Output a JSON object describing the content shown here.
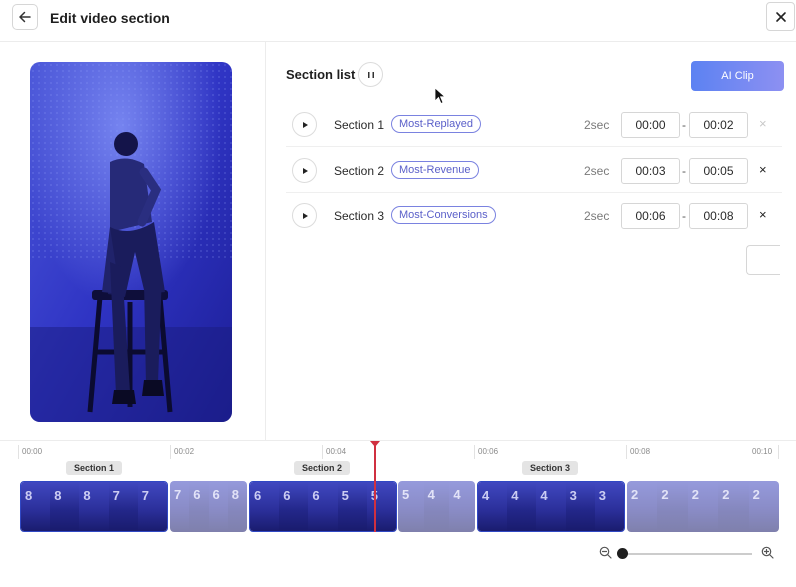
{
  "header": {
    "title": "Edit video section",
    "back_icon": "arrow-left-icon",
    "close_icon": "close-icon"
  },
  "section_list": {
    "title": "Section list",
    "pause_icon": "pause-icon",
    "ai_button_label": "AI Clip",
    "ai_colors": [
      "#5c82f2",
      "#8d90f2"
    ]
  },
  "sections": [
    {
      "name": "Section 1",
      "tag": "Most-Replayed",
      "duration": "2sec",
      "start": "00:00",
      "end": "00:02",
      "dash": "-",
      "remove": "×",
      "remove_disabled": true
    },
    {
      "name": "Section 2",
      "tag": "Most-Revenue",
      "duration": "2sec",
      "start": "00:03",
      "end": "00:05",
      "dash": "-",
      "remove": "×",
      "remove_disabled": false
    },
    {
      "name": "Section 3",
      "tag": "Most-Conversions",
      "duration": "2sec",
      "start": "00:06",
      "end": "00:08",
      "dash": "-",
      "remove": "×",
      "remove_disabled": false
    }
  ],
  "timeline": {
    "ticks": [
      "00:00",
      "00:02",
      "00:04",
      "00:06",
      "00:08",
      "00:10"
    ],
    "section_labels": [
      "Section 1",
      "Section 2",
      "Section 3"
    ],
    "playhead_color": "#d03040",
    "frame_digits_a": [
      "8",
      "8",
      "8",
      "7",
      "7"
    ],
    "frame_digits_b": [
      "7",
      "6",
      "6",
      "8"
    ],
    "frame_digits_c": [
      "6",
      "6",
      "6",
      "5",
      "5"
    ],
    "frame_digits_d": [
      "5",
      "4",
      "4"
    ],
    "frame_digits_e": [
      "4",
      "4",
      "4",
      "3",
      "3"
    ],
    "frame_digits_f": [
      "2",
      "2",
      "2",
      "2",
      "2"
    ],
    "zoom_out_icon": "zoom-out-icon",
    "zoom_in_icon": "zoom-in-icon",
    "zoom_level": 0.0
  }
}
